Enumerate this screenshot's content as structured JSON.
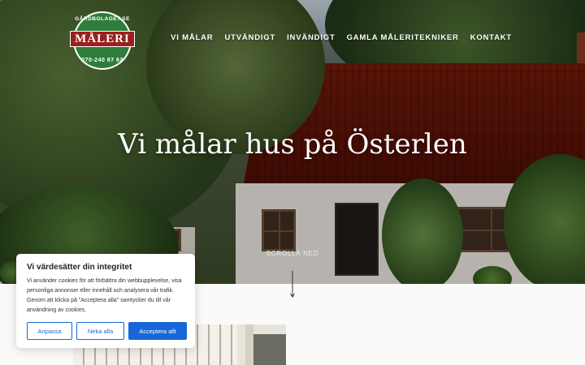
{
  "logo": {
    "top_text": "GÅRDBOLAGET.SE",
    "word": "MÅLERI",
    "bottom_text": "070-240 97 62"
  },
  "nav": {
    "items": [
      {
        "label": "VI MÅLAR"
      },
      {
        "label": "UTVÄNDIGT"
      },
      {
        "label": "INVÄNDIGT"
      },
      {
        "label": "GAMLA MÅLERITEKNIKER"
      },
      {
        "label": "KONTAKT"
      }
    ]
  },
  "hero": {
    "headline": "Vi målar hus på Österlen",
    "scroll_label": "SCROLLA NED"
  },
  "cookie": {
    "title": "Vi värdesätter din integritet",
    "text": "Vi använder cookies för att förbättra din webbupplevelse, visa personliga annonser eller innehåll och analysera vår trafik. Genom att klicka på \"Acceptera alla\" samtycker du till vår användning av cookies.",
    "customize_label": "Anpassa",
    "reject_label": "Neka alla",
    "accept_label": "Acceptera allt"
  },
  "colors": {
    "accent": "#1866d8",
    "logo_green": "#2e7d3a",
    "logo_red": "#9a1f1f"
  }
}
